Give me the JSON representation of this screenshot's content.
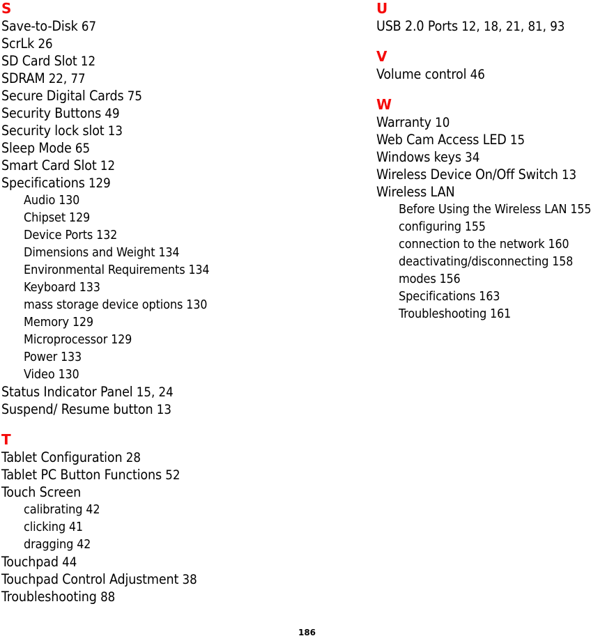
{
  "document": {
    "type": "book-index",
    "page_number": "186",
    "heading_color": "#f50a0a",
    "text_color": "#000000",
    "background_color": "#ffffff"
  },
  "columns": {
    "left": {
      "sections": [
        {
          "letter": "S",
          "entries": [
            {
              "label": "Save-to-Disk",
              "pages": "67",
              "level": 0
            },
            {
              "label": "ScrLk",
              "pages": "26",
              "level": 0
            },
            {
              "label": "SD Card Slot",
              "pages": "12",
              "level": 0
            },
            {
              "label": "SDRAM",
              "pages": "22, 77",
              "level": 0
            },
            {
              "label": "Secure Digital Cards",
              "pages": "75",
              "level": 0
            },
            {
              "label": "Security Buttons",
              "pages": "49",
              "level": 0
            },
            {
              "label": "Security lock slot",
              "pages": "13",
              "level": 0
            },
            {
              "label": "Sleep Mode",
              "pages": "65",
              "level": 0
            },
            {
              "label": "Smart Card Slot",
              "pages": "12",
              "level": 0
            },
            {
              "label": "Specifications",
              "pages": "129",
              "level": 0
            },
            {
              "label": "Audio",
              "pages": "130",
              "level": 1
            },
            {
              "label": "Chipset",
              "pages": "129",
              "level": 1
            },
            {
              "label": "Device Ports",
              "pages": "132",
              "level": 1
            },
            {
              "label": "Dimensions and Weight",
              "pages": "134",
              "level": 1
            },
            {
              "label": "Environmental Requirements",
              "pages": "134",
              "level": 1
            },
            {
              "label": "Keyboard",
              "pages": "133",
              "level": 1
            },
            {
              "label": "mass storage device options",
              "pages": "130",
              "level": 1
            },
            {
              "label": "Memory",
              "pages": "129",
              "level": 1
            },
            {
              "label": "Microprocessor",
              "pages": "129",
              "level": 1
            },
            {
              "label": "Power",
              "pages": "133",
              "level": 1
            },
            {
              "label": "Video",
              "pages": "130",
              "level": 1
            },
            {
              "label": "Status Indicator Panel",
              "pages": "15, 24",
              "level": 0
            },
            {
              "label": "Suspend/ Resume button",
              "pages": "13",
              "level": 0
            }
          ]
        },
        {
          "letter": "T",
          "entries": [
            {
              "label": "Tablet Configuration",
              "pages": "28",
              "level": 0
            },
            {
              "label": "Tablet PC Button Functions",
              "pages": "52",
              "level": 0
            },
            {
              "label": "Touch Screen",
              "pages": "",
              "level": 0
            },
            {
              "label": "calibrating",
              "pages": "42",
              "level": 1
            },
            {
              "label": "clicking",
              "pages": "41",
              "level": 1
            },
            {
              "label": "dragging",
              "pages": "42",
              "level": 1
            },
            {
              "label": "Touchpad",
              "pages": "44",
              "level": 0
            },
            {
              "label": "Touchpad Control Adjustment",
              "pages": "38",
              "level": 0
            },
            {
              "label": "Troubleshooting",
              "pages": "88",
              "level": 0
            }
          ]
        }
      ]
    },
    "right": {
      "sections": [
        {
          "letter": "U",
          "entries": [
            {
              "label": "USB 2.0 Ports",
              "pages": "12, 18, 21, 81, 93",
              "level": 0
            }
          ]
        },
        {
          "letter": "V",
          "entries": [
            {
              "label": "Volume control",
              "pages": "46",
              "level": 0
            }
          ]
        },
        {
          "letter": "W",
          "entries": [
            {
              "label": "Warranty",
              "pages": "10",
              "level": 0
            },
            {
              "label": "Web Cam Access LED",
              "pages": "15",
              "level": 0
            },
            {
              "label": "Windows keys",
              "pages": "34",
              "level": 0
            },
            {
              "label": "Wireless Device On/Off Switch",
              "pages": "13",
              "level": 0
            },
            {
              "label": "Wireless LAN",
              "pages": "",
              "level": 0
            },
            {
              "label": "Before Using the Wireless LAN",
              "pages": "155",
              "level": 1
            },
            {
              "label": "configuring",
              "pages": "155",
              "level": 1
            },
            {
              "label": "connection to the network",
              "pages": "160",
              "level": 1
            },
            {
              "label": "deactivating/disconnecting",
              "pages": "158",
              "level": 1
            },
            {
              "label": "modes",
              "pages": "156",
              "level": 1
            },
            {
              "label": "Specifications",
              "pages": "163",
              "level": 1
            },
            {
              "label": "Troubleshooting",
              "pages": "161",
              "level": 1
            }
          ]
        }
      ]
    }
  }
}
